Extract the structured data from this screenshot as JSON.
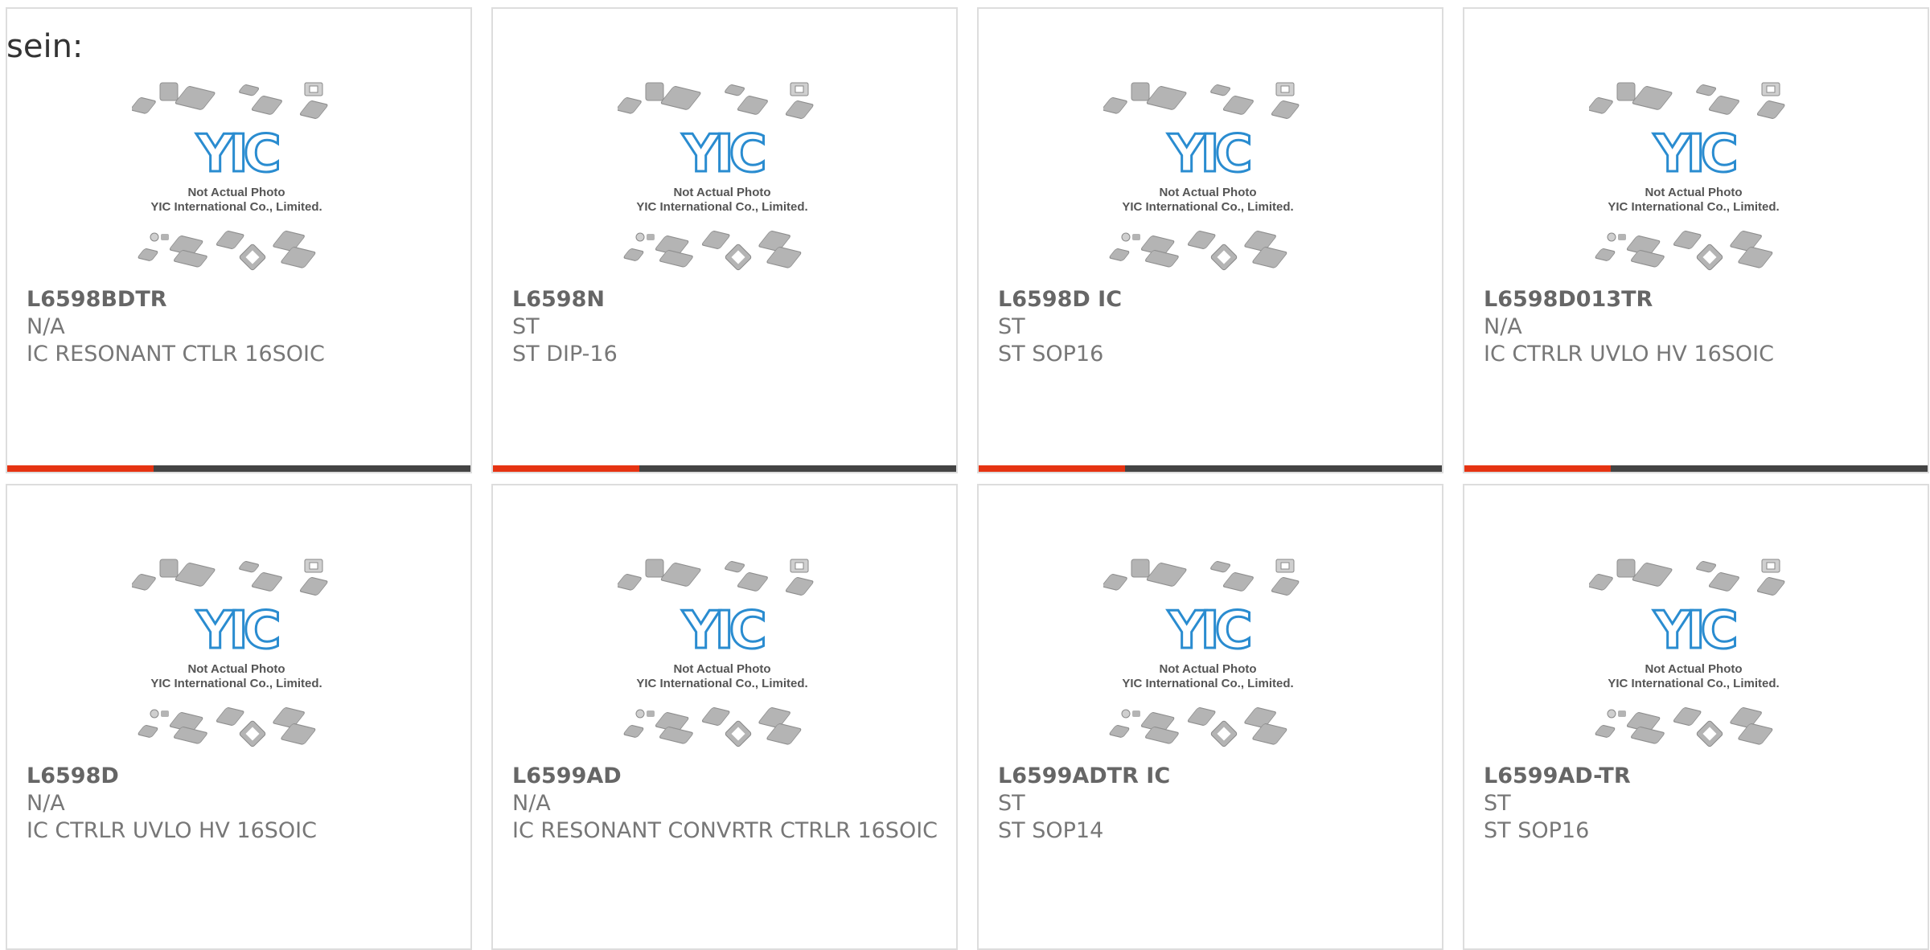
{
  "intro_text": "sein:",
  "colors": {
    "accent": "#e63312",
    "bar": "#444444",
    "logo_blue": "#2a8cd0",
    "chip_gray": "#b4b4b4",
    "photo_caption": "#555555"
  },
  "placeholder_photo": {
    "logo_text": "YIC",
    "caption_line1": "Not Actual Photo",
    "caption_line2": "YIC International Co., Limited."
  },
  "products": [
    {
      "part_number": "L6598BDTR",
      "manufacturer": "N/A",
      "description": "IC RESONANT CTLR 16SOIC",
      "has_accent_bar": true
    },
    {
      "part_number": "L6598N",
      "manufacturer": "ST",
      "description": "ST DIP-16",
      "has_accent_bar": true
    },
    {
      "part_number": "L6598D IC",
      "manufacturer": "ST",
      "description": "ST SOP16",
      "has_accent_bar": true
    },
    {
      "part_number": "L6598D013TR",
      "manufacturer": "N/A",
      "description": "IC CTRLR UVLO HV 16SOIC",
      "has_accent_bar": true
    },
    {
      "part_number": "L6598D",
      "manufacturer": "N/A",
      "description": "IC CTRLR UVLO HV 16SOIC",
      "has_accent_bar": false
    },
    {
      "part_number": "L6599AD",
      "manufacturer": "N/A",
      "description": "IC RESONANT CONVRTR CTRLR 16SOIC",
      "has_accent_bar": false
    },
    {
      "part_number": "L6599ADTR IC",
      "manufacturer": "ST",
      "description": "ST SOP14",
      "has_accent_bar": false
    },
    {
      "part_number": "L6599AD-TR",
      "manufacturer": "ST",
      "description": "ST SOP16",
      "has_accent_bar": false
    }
  ]
}
